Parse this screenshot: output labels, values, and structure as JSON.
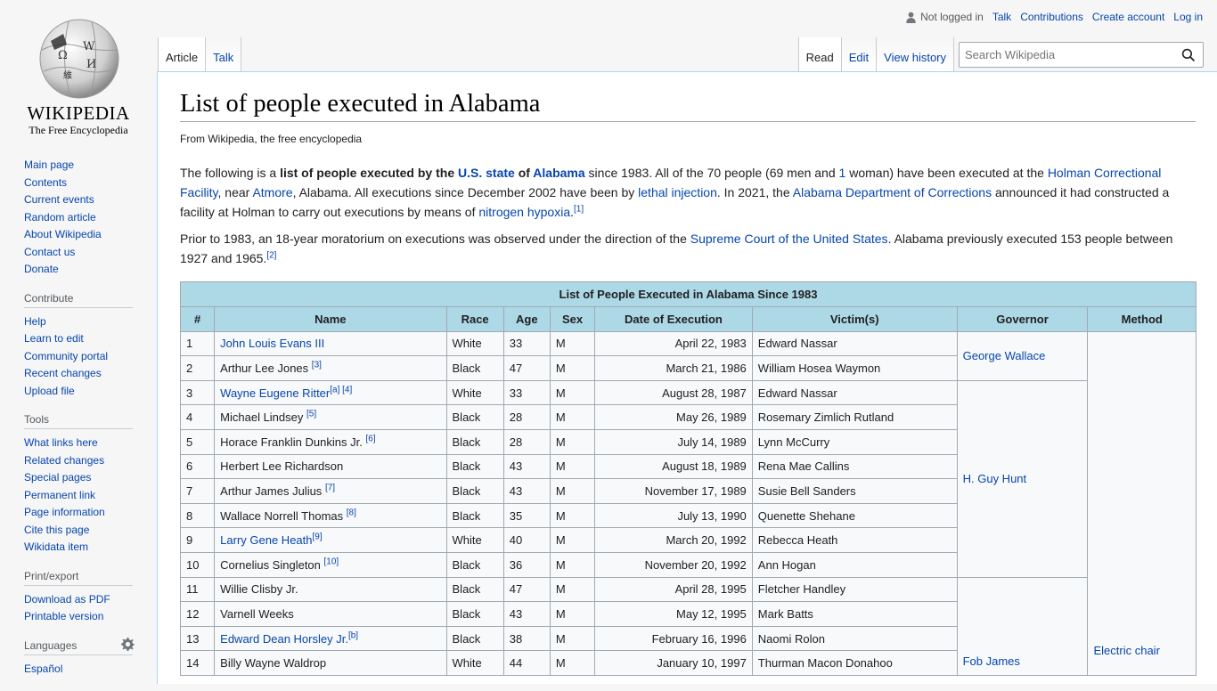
{
  "logo": {
    "wordmark": "Wikipedia",
    "tagline": "The Free Encyclopedia"
  },
  "personal": {
    "not_logged_in": "Not logged in",
    "talk": "Talk",
    "contributions": "Contributions",
    "create_account": "Create account",
    "log_in": "Log in"
  },
  "tabs": {
    "article": "Article",
    "talk": "Talk",
    "read": "Read",
    "edit": "Edit",
    "view_history": "View history"
  },
  "search": {
    "placeholder": "Search Wikipedia"
  },
  "sidebar": {
    "main": [
      "Main page",
      "Contents",
      "Current events",
      "Random article",
      "About Wikipedia",
      "Contact us",
      "Donate"
    ],
    "contribute_heading": "Contribute",
    "contribute": [
      "Help",
      "Learn to edit",
      "Community portal",
      "Recent changes",
      "Upload file"
    ],
    "tools_heading": "Tools",
    "tools": [
      "What links here",
      "Related changes",
      "Special pages",
      "Permanent link",
      "Page information",
      "Cite this page",
      "Wikidata item"
    ],
    "print_heading": "Print/export",
    "print": [
      "Download as PDF",
      "Printable version"
    ],
    "languages_heading": "Languages",
    "languages": [
      "Español"
    ]
  },
  "article": {
    "title": "List of people executed in Alabama",
    "tagline": "From Wikipedia, the free encyclopedia",
    "p1": {
      "t1": "The following is a ",
      "b1": "list of people executed by the ",
      "l1": "U.S. state",
      "b2": " of ",
      "l2": "Alabama",
      "t2": " since 1983. All of the 70 people (69 men and ",
      "l3": "1",
      "t3": " woman) have been executed at the ",
      "l4": "Holman Correctional Facility",
      "t4": ", near ",
      "l5": "Atmore",
      "t5": ", Alabama. All executions since December 2002 have been by ",
      "l6": "lethal injection",
      "t6": ". In 2021, the ",
      "l7": "Alabama Department of Corrections",
      "t7": " announced it had constructed a facility at Holman to carry out executions by means of ",
      "l8": "nitrogen hypoxia",
      "t8": ".",
      "ref": "[1]"
    },
    "p2": {
      "t1": "Prior to 1983, an 18-year moratorium on executions was observed under the direction of the ",
      "l1": "Supreme Court of the United States",
      "t2": ". Alabama previously executed 153 people between 1927 and 1965.",
      "ref": "[2]"
    }
  },
  "table": {
    "caption": "List of People Executed in Alabama Since 1983",
    "headers": [
      "#",
      "Name",
      "Race",
      "Age",
      "Sex",
      "Date of Execution",
      "Victim(s)",
      "Governor",
      "Method"
    ],
    "rows": [
      {
        "n": "1",
        "name": "John Louis Evans III",
        "ref": "",
        "race": "White",
        "age": "33",
        "sex": "M",
        "date": "April 22, 1983",
        "victim": "Edward Nassar"
      },
      {
        "n": "2",
        "name": "Arthur Lee Jones",
        "ref": "[3]",
        "race": "Black",
        "age": "47",
        "sex": "M",
        "date": "March 21, 1986",
        "victim": "William Hosea Waymon"
      },
      {
        "n": "3",
        "name": "Wayne Eugene Ritter",
        "ref": "[a] [4]",
        "race": "White",
        "age": "33",
        "sex": "M",
        "date": "August 28, 1987",
        "victim": "Edward Nassar"
      },
      {
        "n": "4",
        "name": "Michael Lindsey",
        "ref": "[5]",
        "race": "Black",
        "age": "28",
        "sex": "M",
        "date": "May 26, 1989",
        "victim": "Rosemary Zimlich Rutland"
      },
      {
        "n": "5",
        "name": "Horace Franklin Dunkins Jr.",
        "ref": "[6]",
        "race": "Black",
        "age": "28",
        "sex": "M",
        "date": "July 14, 1989",
        "victim": "Lynn McCurry"
      },
      {
        "n": "6",
        "name": "Herbert Lee Richardson",
        "ref": "",
        "race": "Black",
        "age": "43",
        "sex": "M",
        "date": "August 18, 1989",
        "victim": "Rena Mae Callins"
      },
      {
        "n": "7",
        "name": "Arthur James Julius",
        "ref": "[7]",
        "race": "Black",
        "age": "43",
        "sex": "M",
        "date": "November 17, 1989",
        "victim": "Susie Bell Sanders"
      },
      {
        "n": "8",
        "name": "Wallace Norrell Thomas",
        "ref": "[8]",
        "race": "Black",
        "age": "35",
        "sex": "M",
        "date": "July 13, 1990",
        "victim": "Quenette Shehane"
      },
      {
        "n": "9",
        "name": "Larry Gene Heath",
        "ref": "[9]",
        "race": "White",
        "age": "40",
        "sex": "M",
        "date": "March 20, 1992",
        "victim": "Rebecca Heath"
      },
      {
        "n": "10",
        "name": "Cornelius Singleton",
        "ref": "[10]",
        "race": "Black",
        "age": "36",
        "sex": "M",
        "date": "November 20, 1992",
        "victim": "Ann Hogan"
      },
      {
        "n": "11",
        "name": "Willie Clisby Jr.",
        "ref": "",
        "race": "Black",
        "age": "47",
        "sex": "M",
        "date": "April 28, 1995",
        "victim": "Fletcher Handley"
      },
      {
        "n": "12",
        "name": "Varnell Weeks",
        "ref": "",
        "race": "Black",
        "age": "43",
        "sex": "M",
        "date": "May 12, 1995",
        "victim": "Mark Batts"
      },
      {
        "n": "13",
        "name": "Edward Dean Horsley Jr.",
        "ref": "[b]",
        "race": "Black",
        "age": "38",
        "sex": "M",
        "date": "February 16, 1996",
        "victim": "Naomi Rolon"
      },
      {
        "n": "14",
        "name": "Billy Wayne Waldrop",
        "ref": "",
        "race": "White",
        "age": "44",
        "sex": "M",
        "date": "January 10, 1997",
        "victim": "Thurman Macon Donahoo"
      }
    ],
    "governors": [
      "George Wallace",
      "H. Guy Hunt",
      "Fob James"
    ],
    "method": "Electric chair"
  }
}
